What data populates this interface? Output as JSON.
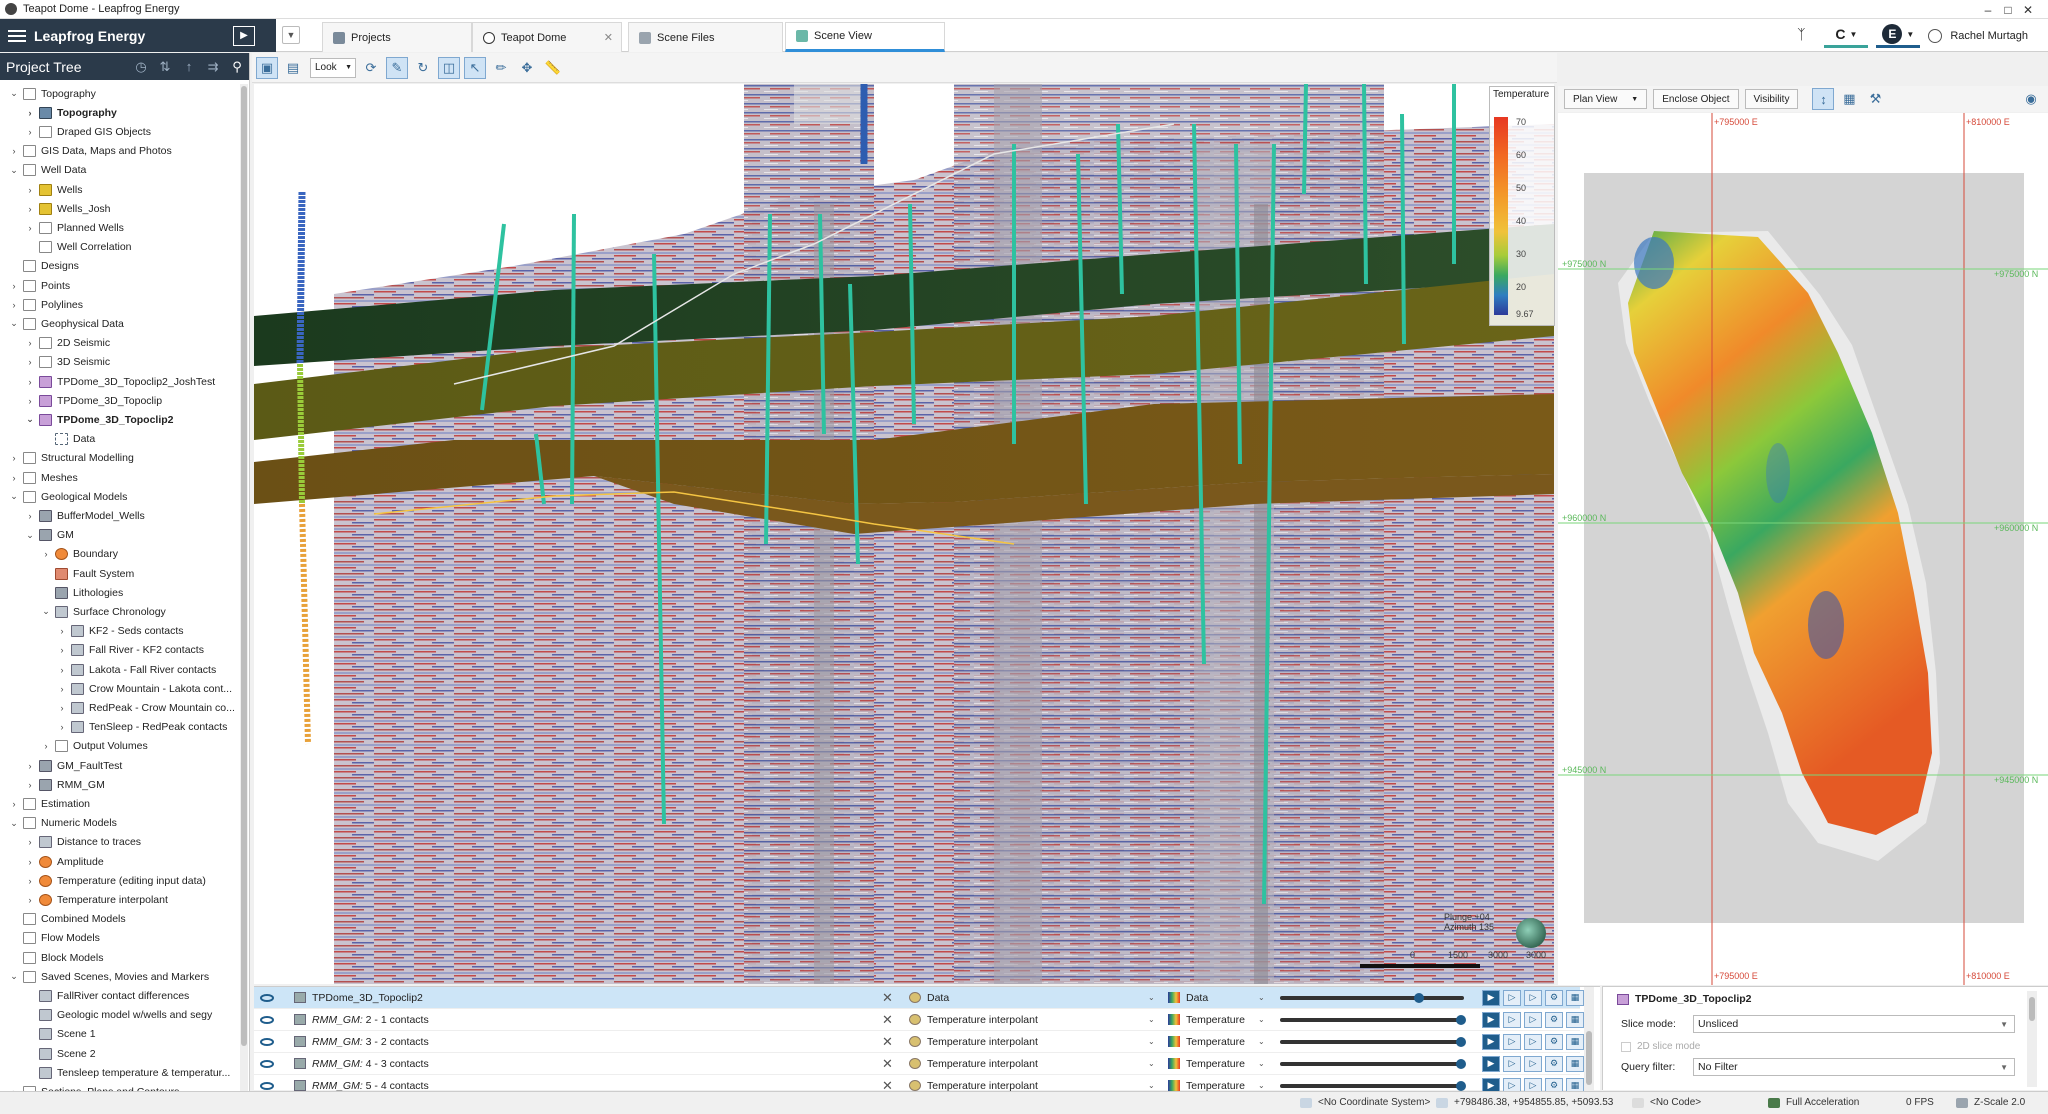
{
  "window": {
    "title": "Teapot Dome - Leapfrog Energy"
  },
  "brand": {
    "title": "Leapfrog Energy"
  },
  "tabs": [
    {
      "label": "Projects"
    },
    {
      "label": "Teapot Dome"
    },
    {
      "label": "Scene Files"
    },
    {
      "label": "Scene View"
    }
  ],
  "header": {
    "user": "Rachel Murtagh",
    "btn1": "C",
    "btn2": "E"
  },
  "tree": {
    "title": "Project Tree",
    "items": [
      {
        "label": "Topography"
      },
      {
        "label": "Topography"
      },
      {
        "label": "Draped GIS Objects"
      },
      {
        "label": "GIS Data, Maps and Photos"
      },
      {
        "label": "Well Data"
      },
      {
        "label": "Wells"
      },
      {
        "label": "Wells_Josh"
      },
      {
        "label": "Planned Wells"
      },
      {
        "label": "Well Correlation"
      },
      {
        "label": "Designs"
      },
      {
        "label": "Points"
      },
      {
        "label": "Polylines"
      },
      {
        "label": "Geophysical Data"
      },
      {
        "label": "2D Seismic"
      },
      {
        "label": "3D Seismic"
      },
      {
        "label": "TPDome_3D_Topoclip2_JoshTest"
      },
      {
        "label": "TPDome_3D_Topoclip"
      },
      {
        "label": "TPDome_3D_Topoclip2"
      },
      {
        "label": "Data"
      },
      {
        "label": "Structural Modelling"
      },
      {
        "label": "Meshes"
      },
      {
        "label": "Geological Models"
      },
      {
        "label": "BufferModel_Wells"
      },
      {
        "label": "GM"
      },
      {
        "label": "Boundary"
      },
      {
        "label": "Fault System"
      },
      {
        "label": "Lithologies"
      },
      {
        "label": "Surface Chronology"
      },
      {
        "label": "KF2 - Seds contacts"
      },
      {
        "label": "Fall River - KF2 contacts"
      },
      {
        "label": "Lakota - Fall River contacts"
      },
      {
        "label": "Crow Mountain - Lakota cont..."
      },
      {
        "label": "RedPeak - Crow Mountain co..."
      },
      {
        "label": "TenSleep - RedPeak contacts"
      },
      {
        "label": "Output Volumes"
      },
      {
        "label": "GM_FaultTest"
      },
      {
        "label": "RMM_GM"
      },
      {
        "label": "Estimation"
      },
      {
        "label": "Numeric Models"
      },
      {
        "label": "Distance to traces"
      },
      {
        "label": "Amplitude"
      },
      {
        "label": "Temperature (editing input data)"
      },
      {
        "label": "Temperature interpolant"
      },
      {
        "label": "Combined Models"
      },
      {
        "label": "Flow Models"
      },
      {
        "label": "Block Models"
      },
      {
        "label": "Saved Scenes, Movies and Markers"
      },
      {
        "label": "FallRiver contact differences"
      },
      {
        "label": "Geologic model w/wells and segy"
      },
      {
        "label": "Scene 1"
      },
      {
        "label": "Scene 2"
      },
      {
        "label": "Tensleep temperature & temperatur..."
      },
      {
        "label": "Sections, Plans and Contours"
      }
    ]
  },
  "toolbar": {
    "look": "Look"
  },
  "legend": {
    "title": "Temperature",
    "ticks": [
      "70",
      "60",
      "50",
      "40",
      "30",
      "20",
      "9.67"
    ],
    "colors": [
      "#e73822",
      "#f39a2a",
      "#f0c23a",
      "#a6cc3a",
      "#3aa860",
      "#2e7ec0",
      "#2d3a9a"
    ]
  },
  "compass": {
    "plunge": "Plunge +04",
    "azimuth": "Azimuth 135"
  },
  "scale": {
    "labels": [
      "0",
      "1500",
      "3000",
      "3000"
    ]
  },
  "plan_view": {
    "buttons": [
      "Plan View",
      "Enclose Object",
      "Visibility"
    ],
    "grid_labels": {
      "east_top": [
        "+795000 E",
        "+810000 E"
      ],
      "east_bottom": [
        "+795000 E",
        "+810000 E"
      ],
      "north_left": [
        "+975000 N",
        "+960000 N",
        "+945000 N"
      ],
      "north_right": [
        "+975000 N",
        "+960000 N",
        "+945000 N"
      ]
    }
  },
  "shape_list": {
    "rows": [
      {
        "prefix": "",
        "name": "TPDome_3D_Topoclip2",
        "data": "Data",
        "colour": "Data",
        "opacity": 0.76
      },
      {
        "prefix": "RMM_GM:",
        "name": " 2 - 1 contacts",
        "data": "Temperature interpolant",
        "colour": "Temperature",
        "opacity": 1.0
      },
      {
        "prefix": "RMM_GM:",
        "name": " 3 - 2 contacts",
        "data": "Temperature interpolant",
        "colour": "Temperature",
        "opacity": 1.0
      },
      {
        "prefix": "RMM_GM:",
        "name": " 4 - 3 contacts",
        "data": "Temperature interpolant",
        "colour": "Temperature",
        "opacity": 1.0
      },
      {
        "prefix": "RMM_GM:",
        "name": " 5 - 4 contacts",
        "data": "Temperature interpolant",
        "colour": "Temperature",
        "opacity": 1.0
      }
    ]
  },
  "properties": {
    "title": "TPDome_3D_Topoclip2",
    "slice_mode_label": "Slice mode:",
    "slice_mode_value": "Unsliced",
    "slice_2d_label": "2D slice mode",
    "query_filter_label": "Query filter:",
    "query_filter_value": "No Filter"
  },
  "status": {
    "coord_system": "<No Coordinate System>",
    "coords": "+798486.38, +954855.85, +5093.53",
    "code": "<No Code>",
    "accel": "Full Acceleration",
    "fps": "0 FPS",
    "zscale": "Z-Scale 2.0"
  }
}
